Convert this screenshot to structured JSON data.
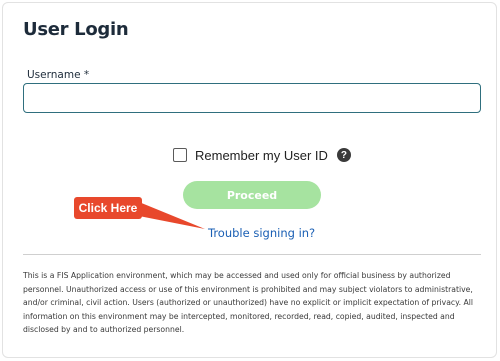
{
  "login": {
    "title": "User Login",
    "username_label": "Username *",
    "username_value": "",
    "remember_label": "Remember my User ID",
    "remember_checked": false,
    "help_symbol": "?",
    "proceed_label": "Proceed",
    "trouble_link": "Trouble signing in?",
    "disclaimer": "This is a FIS Application environment, which may be accessed and used only for official business by authorized personnel. Unauthorized access or use of this environment is prohibited and may subject violators to administrative, and/or criminal, civil action. Users (authorized or unauthorized) have no explicit or implicit expectation of privacy. All information on this environment may be intercepted, monitored, recorded, read, copied, audited, inspected and disclosed by and to authorized personnel."
  },
  "annotation": {
    "callout_label": "Click Here",
    "callout_color": "#e8482c"
  },
  "icons": {
    "help": "question-circle-icon",
    "arrow": "callout-arrow-icon"
  },
  "colors": {
    "proceed_bg": "#a6e3a0",
    "link": "#1a5fb4",
    "input_border": "#2f6f7e",
    "title": "#1d2b3a"
  }
}
